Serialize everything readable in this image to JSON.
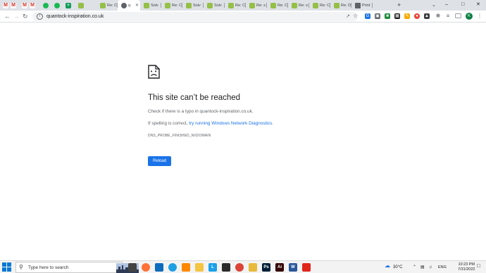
{
  "tabs": [
    {
      "title": "",
      "favicon": "gmail-icon"
    },
    {
      "title": "",
      "favicon": "gmail-icon"
    },
    {
      "title": "",
      "favicon": "gmail-icon"
    },
    {
      "title": "",
      "favicon": "gmail-icon"
    },
    {
      "title": "",
      "favicon": "spotify-icon"
    },
    {
      "title": "",
      "favicon": "spotify-icon"
    },
    {
      "title": "",
      "favicon": "plus-icon"
    },
    {
      "title": "",
      "favicon": "shopify-icon"
    },
    {
      "title": "Re: C",
      "favicon": "shopify-icon"
    },
    {
      "title": "q",
      "favicon": "globe-icon",
      "active": true
    },
    {
      "title": "Solv",
      "favicon": "shopify-icon"
    },
    {
      "title": "Re: C",
      "favicon": "shopify-icon"
    },
    {
      "title": "Solv",
      "favicon": "shopify-icon"
    },
    {
      "title": "Solv",
      "favicon": "shopify-icon"
    },
    {
      "title": "Re: C",
      "favicon": "shopify-icon"
    },
    {
      "title": "Re: s",
      "favicon": "shopify-icon"
    },
    {
      "title": "Re: C",
      "favicon": "shopify-icon"
    },
    {
      "title": "Re: s",
      "favicon": "shopify-icon"
    },
    {
      "title": "Re: C",
      "favicon": "shopify-icon"
    },
    {
      "title": "Re: D",
      "favicon": "shopify-icon"
    },
    {
      "title": "Print",
      "favicon": "folder-icon"
    }
  ],
  "toolbar": {
    "url": "quantock-inspiration.co.uk",
    "profile_initial": "K"
  },
  "error": {
    "title": "This site can’t be reached",
    "line1": "Check if there is a typo in quantock-inspiration.co.uk.",
    "line2_prefix": "If spelling is correct, ",
    "line2_link": "try running Windows Network Diagnostics",
    "line2_suffix": ".",
    "code": "DNS_PROBE_FINISHED_NXDOMAIN",
    "reload_label": "Reload"
  },
  "taskbar": {
    "search_placeholder": "Type here to search",
    "apps": [
      {
        "name": "task-view-icon",
        "label": "",
        "color": "#444444"
      },
      {
        "name": "firefox-icon",
        "label": "",
        "color": "#ff7139"
      },
      {
        "name": "mail-icon",
        "label": "",
        "color": "#0f6cbd"
      },
      {
        "name": "edge-icon",
        "label": "",
        "color": "#1fa0e2"
      },
      {
        "name": "vlc-icon",
        "label": "",
        "color": "#ff8800"
      },
      {
        "name": "file-explorer-icon",
        "label": "",
        "color": "#f4c542"
      },
      {
        "name": "lightshot-icon",
        "label": "L",
        "color": "#1aa1e8"
      },
      {
        "name": "terminal-icon",
        "label": "",
        "color": "#2b2b2b"
      },
      {
        "name": "chrome-icon",
        "label": "",
        "color": "#db4437",
        "active": true
      },
      {
        "name": "folder-icon",
        "label": "",
        "color": "#e8b93a"
      },
      {
        "name": "photoshop-icon",
        "label": "Ps",
        "color": "#001e36"
      },
      {
        "name": "illustrator-icon",
        "label": "Ai",
        "color": "#330000"
      },
      {
        "name": "word-icon",
        "label": "W",
        "color": "#2b579a"
      },
      {
        "name": "app-icon",
        "label": "",
        "color": "#e0261b"
      }
    ],
    "weather": "30°C",
    "language": "ENG",
    "time": "10:23 PM",
    "date": "7/31/2022"
  },
  "colors": {
    "accent": "#1a73e8",
    "tabstrip": "#dee1e6"
  }
}
